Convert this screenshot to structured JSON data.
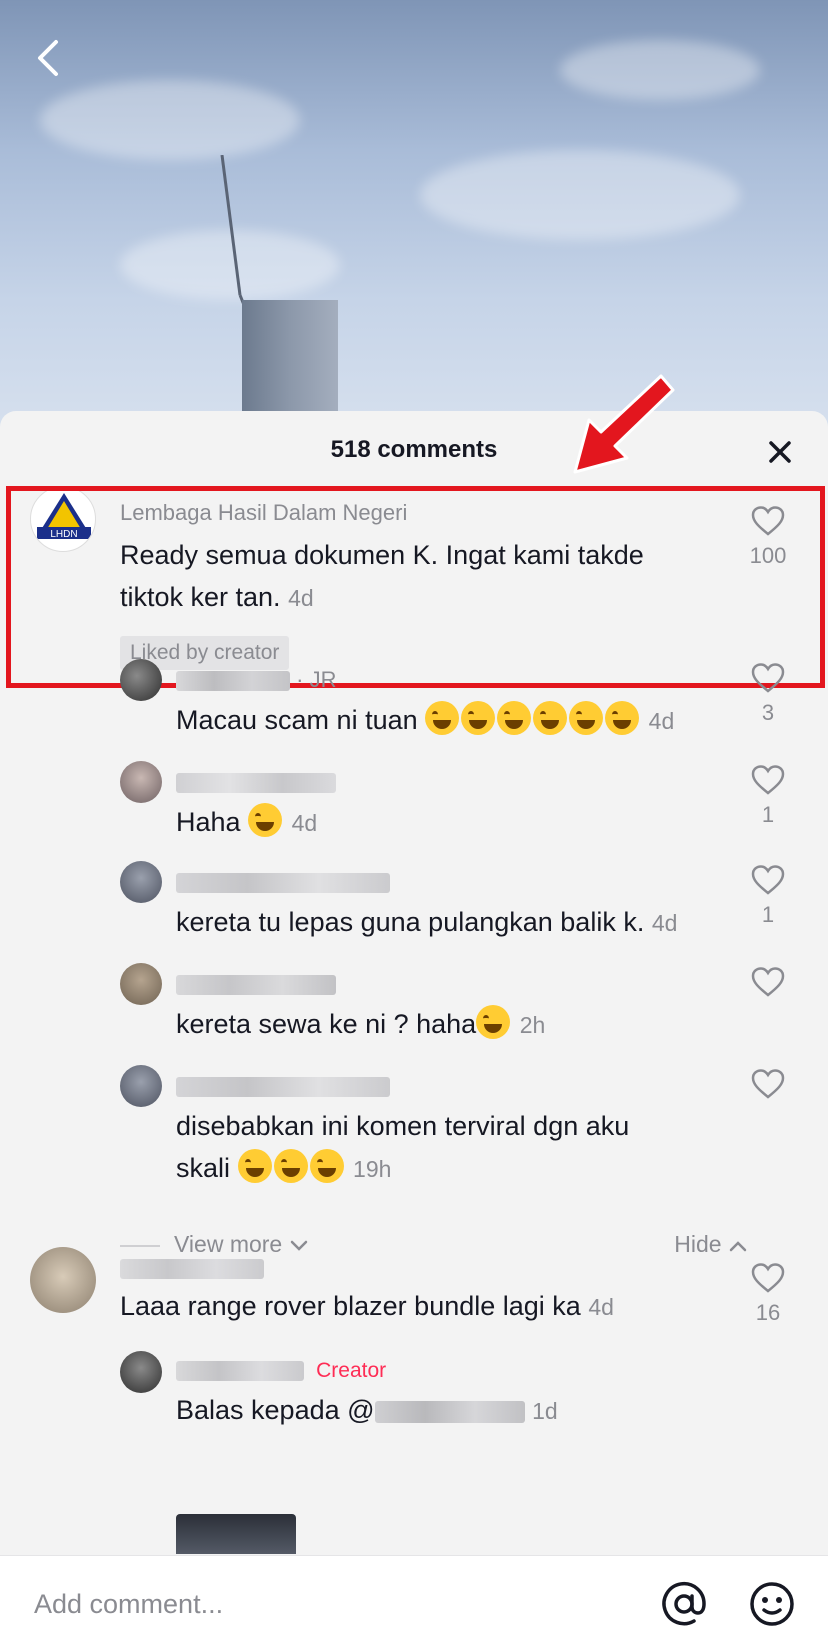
{
  "header": {
    "comment_count_label": "518 comments"
  },
  "main_comment": {
    "username": "Lembaga Hasil Dalam Negeri",
    "text": "Ready semua dokumen K. Ingat kami takde tiktok ker tan.",
    "time": "4d",
    "likes": "100",
    "liked_badge": "Liked by creator",
    "avatar_text": "LHDN"
  },
  "replies": [
    {
      "tag": "· JR",
      "text": "Macau scam ni tuan",
      "emoji_count": 6,
      "time": "4d",
      "likes": "3"
    },
    {
      "tag": "",
      "text": "Haha",
      "emoji_count": 1,
      "time": "4d",
      "likes": "1"
    },
    {
      "tag": "",
      "text": "kereta tu lepas guna pulangkan balik k.",
      "emoji_count": 0,
      "time": "4d",
      "likes": "1"
    },
    {
      "tag": "",
      "text": "kereta sewa ke ni ? haha",
      "emoji_count": 1,
      "time": "2h",
      "likes": ""
    },
    {
      "tag": "",
      "text_line1": "disebabkan ini komen terviral dgn aku",
      "text_line2": "skali",
      "emoji_count": 3,
      "time": "19h",
      "likes": ""
    }
  ],
  "thread_controls": {
    "view_more": "View more",
    "hide": "Hide"
  },
  "second_comment": {
    "text": "Laaa range rover blazer bundle lagi ka",
    "time": "4d",
    "likes": "16"
  },
  "creator_reply": {
    "creator_tag": "Creator",
    "text_prefix": "Balas kepada @",
    "time": "1d"
  },
  "input": {
    "placeholder": "Add comment..."
  },
  "icons": [
    "back-chevron-icon",
    "close-icon",
    "heart-icon",
    "at-sign-icon",
    "emoji-face-icon",
    "red-arrow-annotation"
  ],
  "colors": {
    "highlight": "#e3161e",
    "creator": "#fe2c55",
    "sheet_bg": "#f3f3f3"
  }
}
